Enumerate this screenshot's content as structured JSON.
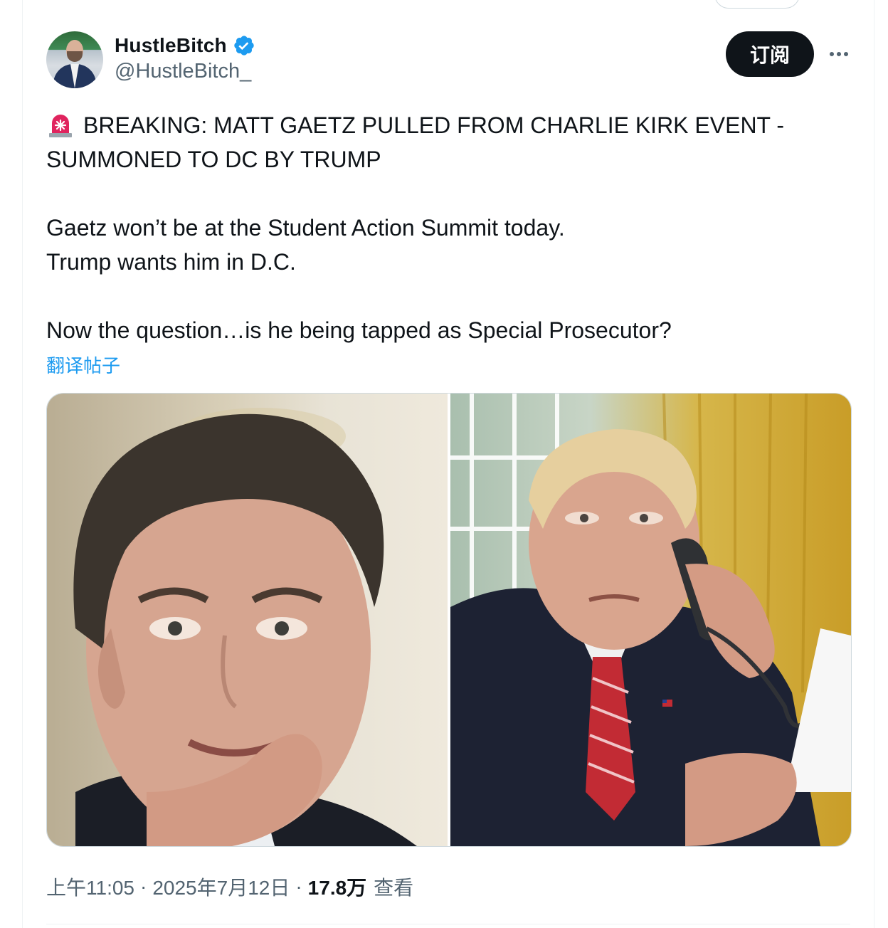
{
  "user": {
    "display_name": "HustleBitch",
    "handle": "@HustleBitch_",
    "verified": true
  },
  "actions": {
    "subscribe_label": "订阅"
  },
  "tweet": {
    "headline": "BREAKING: MATT GAETZ PULLED FROM CHARLIE KIRK EVENT - SUMMONED TO DC BY TRUMP",
    "paragraph_1": "Gaetz won’t be at the Student Action Summit today.\nTrump wants him in D.C.",
    "paragraph_2": "Now the question…is he being tapped as Special Prosecutor?",
    "translate_label": "翻译帖子"
  },
  "meta": {
    "time": "上午11:05",
    "date": "2025年7月12日",
    "views_count": "17.8万",
    "views_label": "查看",
    "separator": "·"
  },
  "colors": {
    "accent": "#1d9bf0",
    "text_primary": "#0f1419",
    "text_secondary": "#536471",
    "verified_badge": "#1d9bf0",
    "siren_red": "#e0245e"
  },
  "icons": {
    "verified": "verified-badge-icon",
    "siren": "rotating-light-emoji-icon",
    "more": "more-horizontal-icon"
  }
}
